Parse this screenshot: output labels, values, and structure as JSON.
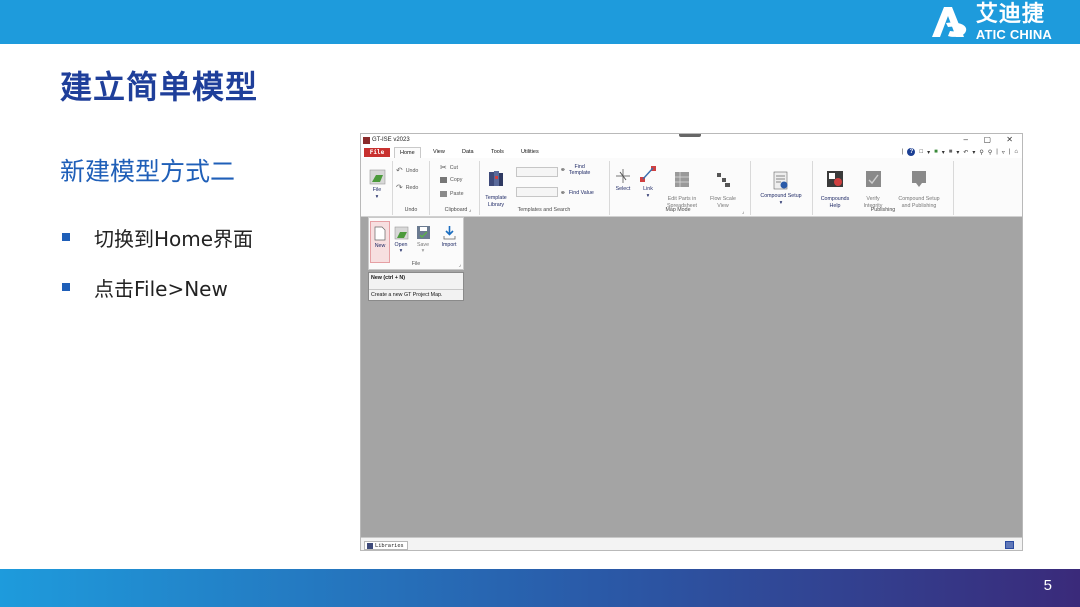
{
  "brand": {
    "name_cn": "艾迪捷",
    "name_en": "ATIC CHINA",
    "color": "#1e9bdc"
  },
  "slide": {
    "title": "建立简单模型",
    "subtitle": "新建模型方式二",
    "bullets": [
      "切换到Home界面",
      "点击File>New"
    ],
    "page_number": "5"
  },
  "app": {
    "window_title": "GT-ISE v2023",
    "window_controls": [
      "–",
      "▢",
      "✕"
    ],
    "file_tab": "File",
    "menu_tabs": [
      "Home",
      "View",
      "Data",
      "Tools",
      "Utilities"
    ],
    "active_tab": "Home",
    "ribbon": {
      "file": {
        "label": "File",
        "group": ""
      },
      "undo_group": {
        "undo": "Undo",
        "redo": "Redo",
        "group": "Undo"
      },
      "clipboard_group": {
        "cut": "Cut",
        "copy": "Copy",
        "paste": "Paste",
        "group": "Clipboard"
      },
      "templates_group": {
        "template_library": "Template\nLibrary",
        "find_template": "Find\nTemplate",
        "find_value": "Find Value",
        "group": "Templates and Search"
      },
      "map_mode_group": {
        "select": "Select",
        "link": "Link",
        "edit_parts": "Edit Parts in\nSpreadsheet",
        "flow_scale": "Flow Scale\nView",
        "group": "Map Mode"
      },
      "compound_group": {
        "compound_setup": "Compound Setup",
        "group": ""
      },
      "publishing_group": {
        "compounds_help": "Compounds\nHelp",
        "verify_integrity": "Verify\nIntegrity",
        "compound_setup_publishing": "Compound Setup\nand Publishing",
        "group": "Publishing"
      }
    },
    "file_dropdown": {
      "buttons": [
        "New",
        "Open",
        "Save",
        "Import"
      ],
      "group": "File"
    },
    "tooltip": {
      "title": "New (ctrl + N)",
      "description": "Create a new GT Project Map."
    },
    "status_tab": "Libraries",
    "colors": {
      "file_tab": "#c8312f",
      "canvas": "#a4a4a4",
      "ribbon": "#fbfbfb",
      "highlight": "#f7dfe0"
    }
  }
}
